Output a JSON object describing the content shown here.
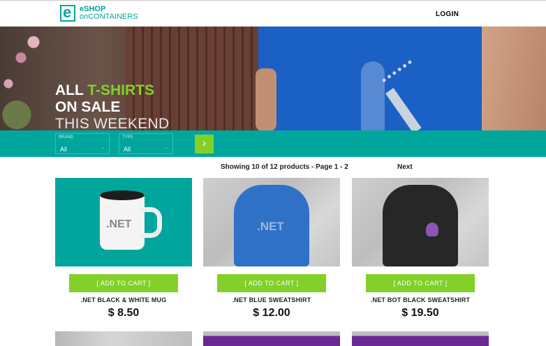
{
  "header": {
    "logo_mark": "e",
    "logo_line1": "eSHOP",
    "logo_line2": "onCONTAINERS",
    "login": "LOGIN"
  },
  "hero": {
    "line1_prefix": "ALL ",
    "line1_accent": "T-SHIRTS",
    "line2": "ON SALE",
    "line3": "THIS WEEKEND"
  },
  "filters": {
    "brand": {
      "label": "BRAND",
      "value": "All"
    },
    "type": {
      "label": "TYPE",
      "value": "All"
    },
    "submit_icon": "chevron-right-icon"
  },
  "paging": {
    "summary": "Showing 10 of 12 products - Page 1 - 2",
    "next": "Next"
  },
  "products": [
    {
      "name": ".NET BLACK & WHITE MUG",
      "price": "$ 8.50",
      "button": "[ ADD TO CART ]",
      "image_text": ".NET"
    },
    {
      "name": ".NET BLUE SWEATSHIRT",
      "price": "$ 12.00",
      "button": "[ ADD TO CART ]",
      "image_text": ".NET"
    },
    {
      "name": ".NET BOT BLACK SWEATSHIRT",
      "price": "$ 19.50",
      "button": "[ ADD TO CART ]"
    }
  ],
  "colors": {
    "brand_teal": "#00a69c",
    "accent_green": "#83d02a"
  }
}
